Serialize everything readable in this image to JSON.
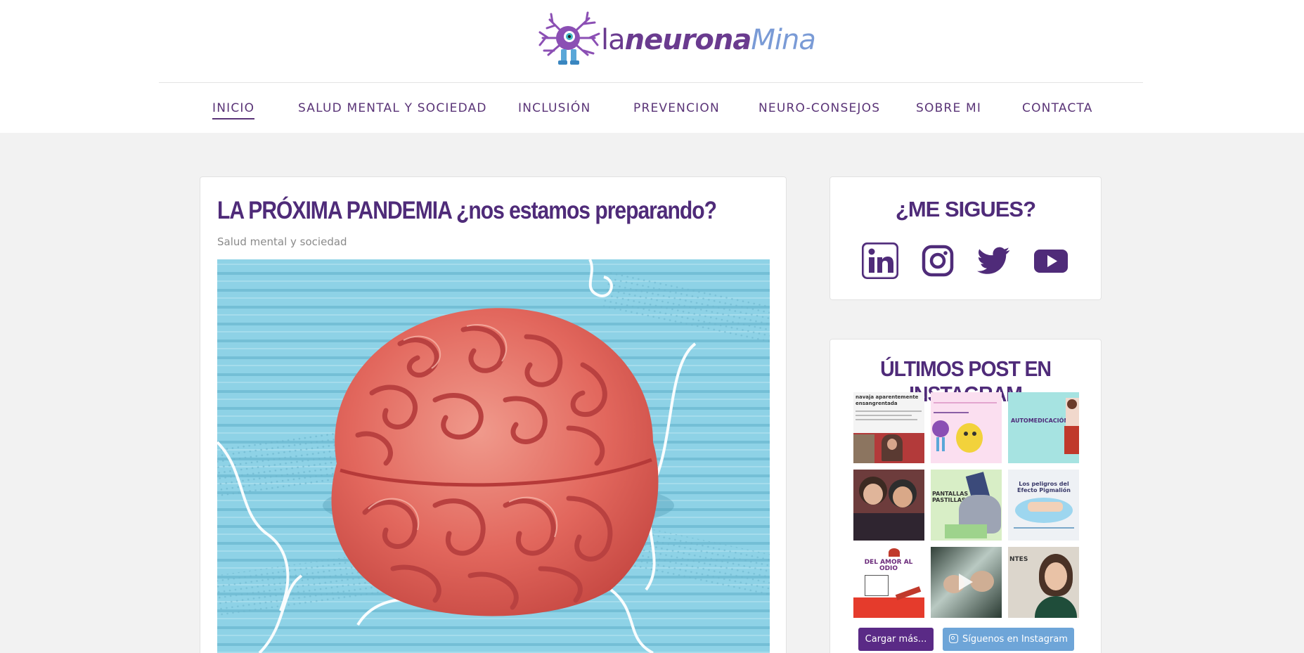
{
  "header": {
    "logo": {
      "part1": "la",
      "part2": "neurona",
      "part3": "Mina"
    },
    "nav": [
      {
        "label": "INICIO",
        "active": true
      },
      {
        "label": "SALUD MENTAL Y SOCIEDAD",
        "active": false
      },
      {
        "label": "INCLUSIÓN",
        "active": false
      },
      {
        "label": "PREVENCION",
        "active": false
      },
      {
        "label": "NEURO-CONSEJOS",
        "active": false
      },
      {
        "label": "SOBRE MI",
        "active": false
      },
      {
        "label": "CONTACTA",
        "active": false
      }
    ]
  },
  "article": {
    "title": "LA PRÓXIMA PANDEMIA ¿nos estamos preparando?",
    "category": "Salud mental y sociedad",
    "image_icon": "brain-on-surgical-masks-image"
  },
  "sidebar": {
    "follow": {
      "title": "¿ME SIGUES?",
      "icons": [
        "linkedin-icon",
        "instagram-icon",
        "twitter-icon",
        "youtube-icon"
      ]
    },
    "instagram": {
      "title": "ÚLTIMOS POST EN INSTAGRAM",
      "thumbs": [
        {
          "text": "navaja aparentemente ensangrentada"
        },
        {
          "text": ""
        },
        {
          "text": "AUTOMEDICACIÓN"
        },
        {
          "text": ""
        },
        {
          "text": "PANTALLAS PASTILLAS"
        },
        {
          "text": "Los peligros del Efecto Pigmalión"
        },
        {
          "text": "DEL AMOR AL ODIO"
        },
        {
          "text": ""
        },
        {
          "text": "NTES"
        }
      ],
      "load_more_label": "Cargar más...",
      "follow_label": "Síguenos en Instagram"
    }
  },
  "colors": {
    "brand_purple": "#4f2b79",
    "nav_purple": "#5a3477",
    "button_purple": "#5a2a86",
    "button_blue": "#6ea5d8",
    "page_bg": "#f2f2f2"
  }
}
